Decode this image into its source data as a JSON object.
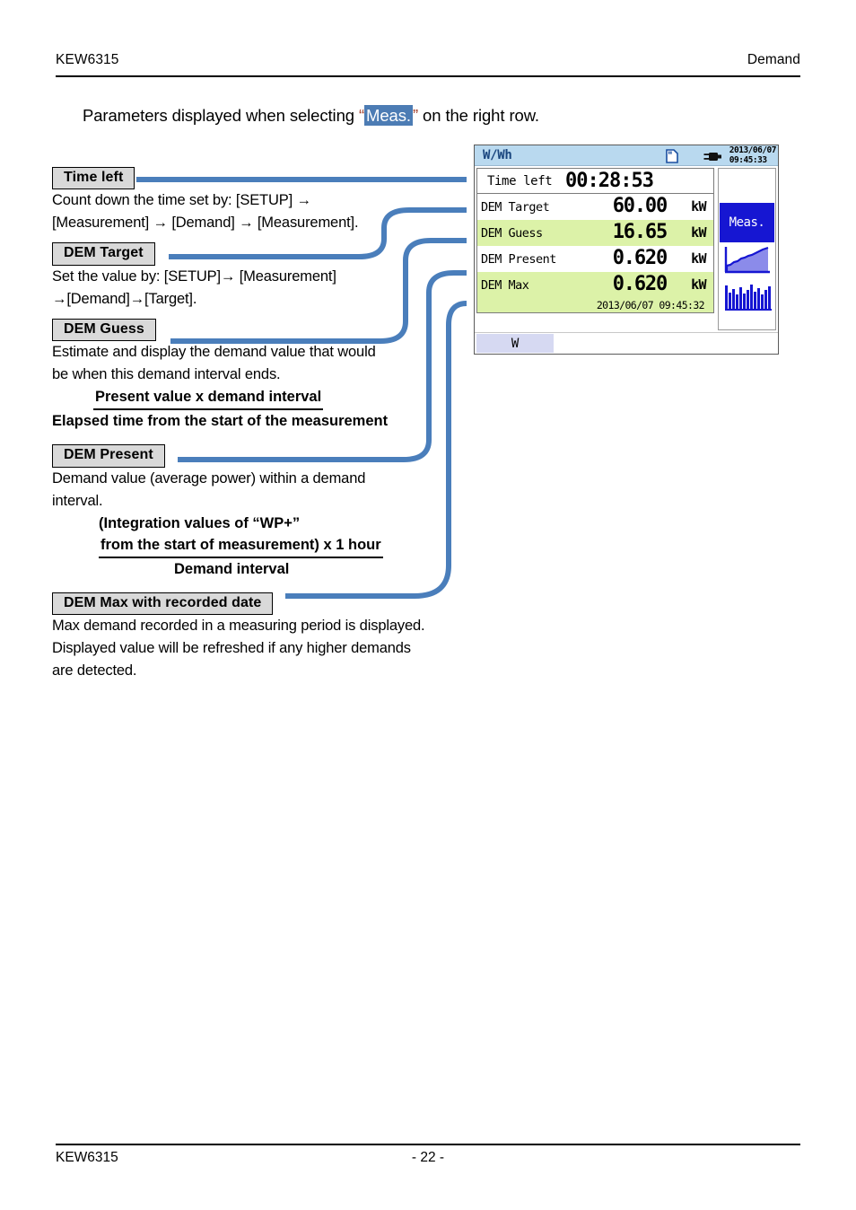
{
  "header": {
    "left": "KEW6315",
    "right": "Demand"
  },
  "intro": {
    "before": "Parameters displayed when selecting ",
    "quote_open": "“",
    "highlight": "Meas.",
    "quote_close": "”",
    "after": " on the right row."
  },
  "sections": [
    {
      "callout": "Time left",
      "lines": [
        "Count down the time set by:    [SETUP] →",
        "[Measurement] → [Demand] → [Measurement]."
      ]
    },
    {
      "callout": "DEM Target",
      "lines": [
        "Set the value by: [SETUP]→ [Measurement]",
        "→[Demand]→[Target]."
      ]
    },
    {
      "callout": "DEM Guess",
      "lines": [
        "Estimate and display the demand value that would",
        "be when this demand interval ends."
      ],
      "formula": {
        "numerator": "Present value x demand interval",
        "denominator": "Elapsed time from the start of the measurement"
      }
    },
    {
      "callout": "DEM Present",
      "lines": [
        "Demand value (average power) within a demand",
        "interval."
      ],
      "formula": {
        "numerator_line1": "(Integration values of “WP+”",
        "numerator_line2": "from the start of measurement) x 1 hour",
        "denominator": "Demand interval"
      }
    },
    {
      "callout": "DEM Max with recorded date",
      "lines": [
        "Max demand recorded in a measuring period is displayed.",
        "Displayed value will be refreshed if any higher demands",
        "are detected."
      ]
    }
  ],
  "lcd": {
    "title": "W/Wh",
    "sd_icon": "sd-card-icon",
    "power_icon": "power-plug-icon",
    "clock_date": "2013/06/07",
    "clock_time": "09:45:33",
    "time_left": {
      "label": "Time left",
      "value": "00:28:53"
    },
    "rows": [
      {
        "label": "DEM Target",
        "value": "60.00",
        "unit": "kW",
        "shade": "plain"
      },
      {
        "label": "DEM Guess",
        "value": "16.65",
        "unit": "kW",
        "shade": "alt"
      },
      {
        "label": "DEM Present",
        "value": "0.620",
        "unit": "kW",
        "shade": "plain"
      },
      {
        "label": "DEM Max",
        "value": "0.620",
        "unit": "kW",
        "shade": "alt"
      }
    ],
    "recorded_stamp": "2013/06/07 09:45:32",
    "softkeys": {
      "meas_label": "Meas.",
      "graph_icon": "trend-graph-icon",
      "bar_icon": "bar-graph-icon"
    },
    "footer_tab": "W",
    "colors": {
      "titlebar": "#b9d9ef",
      "title_text": "#19457e",
      "row_shade": "#dcf2a8",
      "key_active": "#1616d2",
      "footer_tab": "#d6d9f2"
    }
  },
  "connector_color": "#4a7ebb",
  "footer": {
    "left": "KEW6315",
    "page": "- 22 -"
  }
}
